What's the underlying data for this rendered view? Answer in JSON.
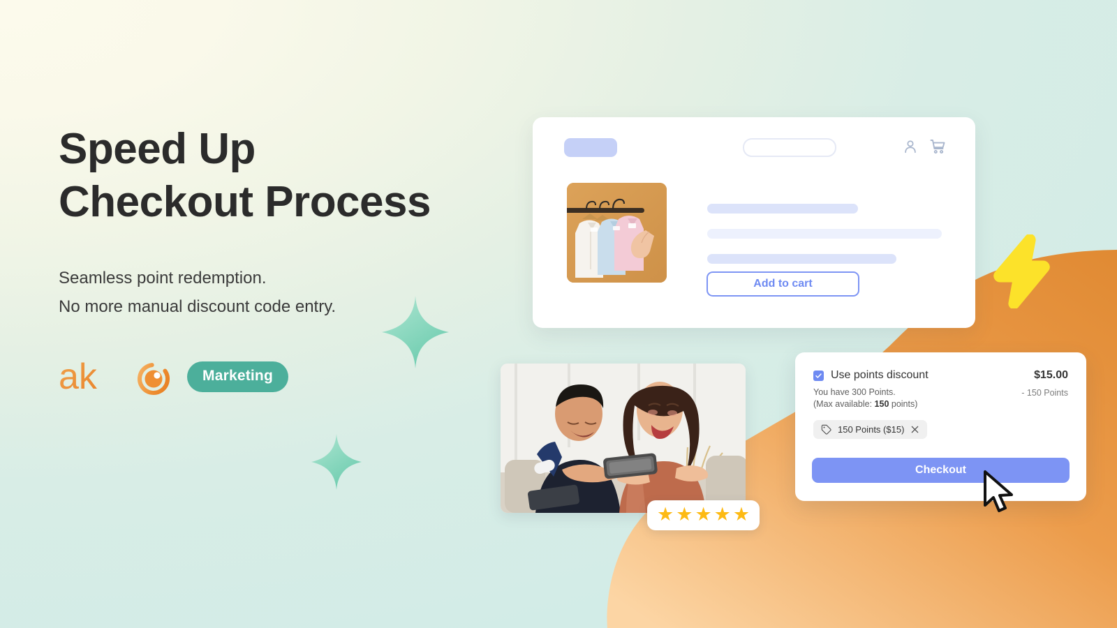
{
  "headline": {
    "line1": "Speed Up",
    "line2": "Checkout Process"
  },
  "subcopy": {
    "line1": "Seamless point redemption.",
    "line2": "No more manual discount code entry."
  },
  "brand": {
    "logo_text": "ako",
    "logo_icon": "ako-eye-icon",
    "badge_label": "Marketing",
    "badge_color": "#4CAF9B",
    "logo_color": "#EF9040"
  },
  "product_card": {
    "logo_placeholder": "",
    "search_placeholder": "",
    "account_icon": "user-icon",
    "cart_icon": "shopping-cart-icon",
    "product_image_alt": "shirts-on-hangers-photo",
    "add_to_cart_label": "Add to cart",
    "accent_color": "#7D94F4"
  },
  "people_photo": {
    "alt": "couple-looking-at-phone-photo",
    "rating_stars": 5,
    "star_glyph": "★",
    "star_color": "#FDBA14"
  },
  "checkout_card": {
    "checkbox_checked": true,
    "checkbox_icon": "check-icon",
    "use_points_label": "Use points discount",
    "price": "$15.00",
    "points_deduction": "- 150 Points",
    "balance_line": "You have 300 Points.",
    "max_prefix": "(Max available: ",
    "max_value": "150",
    "max_suffix": " points)",
    "chip": {
      "icon": "price-tag-icon",
      "label": "150 Points ($15)",
      "remove_icon": "close-icon"
    },
    "checkout_label": "Checkout",
    "button_color": "#7D94F4"
  },
  "decorations": {
    "lightning_icon": "lightning-bolt-icon",
    "lightning_color": "#FCE22A",
    "sparkle_icon": "four-point-sparkle-icon",
    "sparkle_color": "#7FD7BC",
    "blob_color_start": "#E3892F",
    "blob_color_end": "#FBD09A",
    "cursor_icon": "mouse-pointer-icon"
  },
  "background": {
    "top_left": "#FCFAEC",
    "bottom_right": "#D2ECE7"
  }
}
